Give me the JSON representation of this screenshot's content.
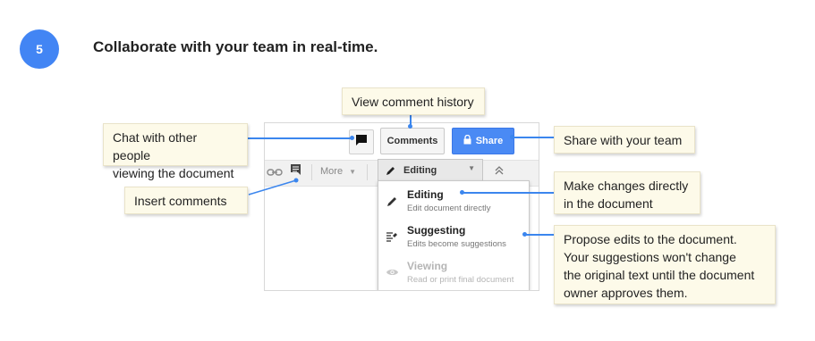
{
  "step": {
    "number": "5",
    "heading": "Collaborate with your team in real-time."
  },
  "toolbar": {
    "chat_icon": "chat-bubble-icon",
    "comments_label": "Comments",
    "share_label": "Share",
    "share_icon": "lock-icon",
    "link_icon": "link-icon",
    "insert_comment_icon": "insert-comment-icon",
    "more_label": "More",
    "editing_label": "Editing",
    "collapse_icon": "double-chevron-up-icon"
  },
  "mode_menu": {
    "items": [
      {
        "title": "Editing",
        "description": "Edit document directly",
        "icon": "pencil-icon",
        "disabled": false
      },
      {
        "title": "Suggesting",
        "description": "Edits become suggestions",
        "icon": "suggest-icon",
        "disabled": false
      },
      {
        "title": "Viewing",
        "description": "Read or print final document",
        "icon": "eye-icon",
        "disabled": true
      }
    ]
  },
  "callouts": {
    "comment_history": "View comment history",
    "chat_line1": "Chat with other people",
    "chat_line2": "viewing the document",
    "insert_comments": "Insert comments",
    "share": "Share with your team",
    "editing_line1": "Make changes directly",
    "editing_line2": "in the document",
    "suggest_line1": "Propose edits to the document.",
    "suggest_line2": "Your suggestions won't change",
    "suggest_line3": "the original text until the document",
    "suggest_line4": "owner approves them."
  },
  "colors": {
    "accent": "#4285f4",
    "share_button": "#4a8af4",
    "callout_bg": "#fdfae9",
    "connector": "#3b86ee"
  }
}
